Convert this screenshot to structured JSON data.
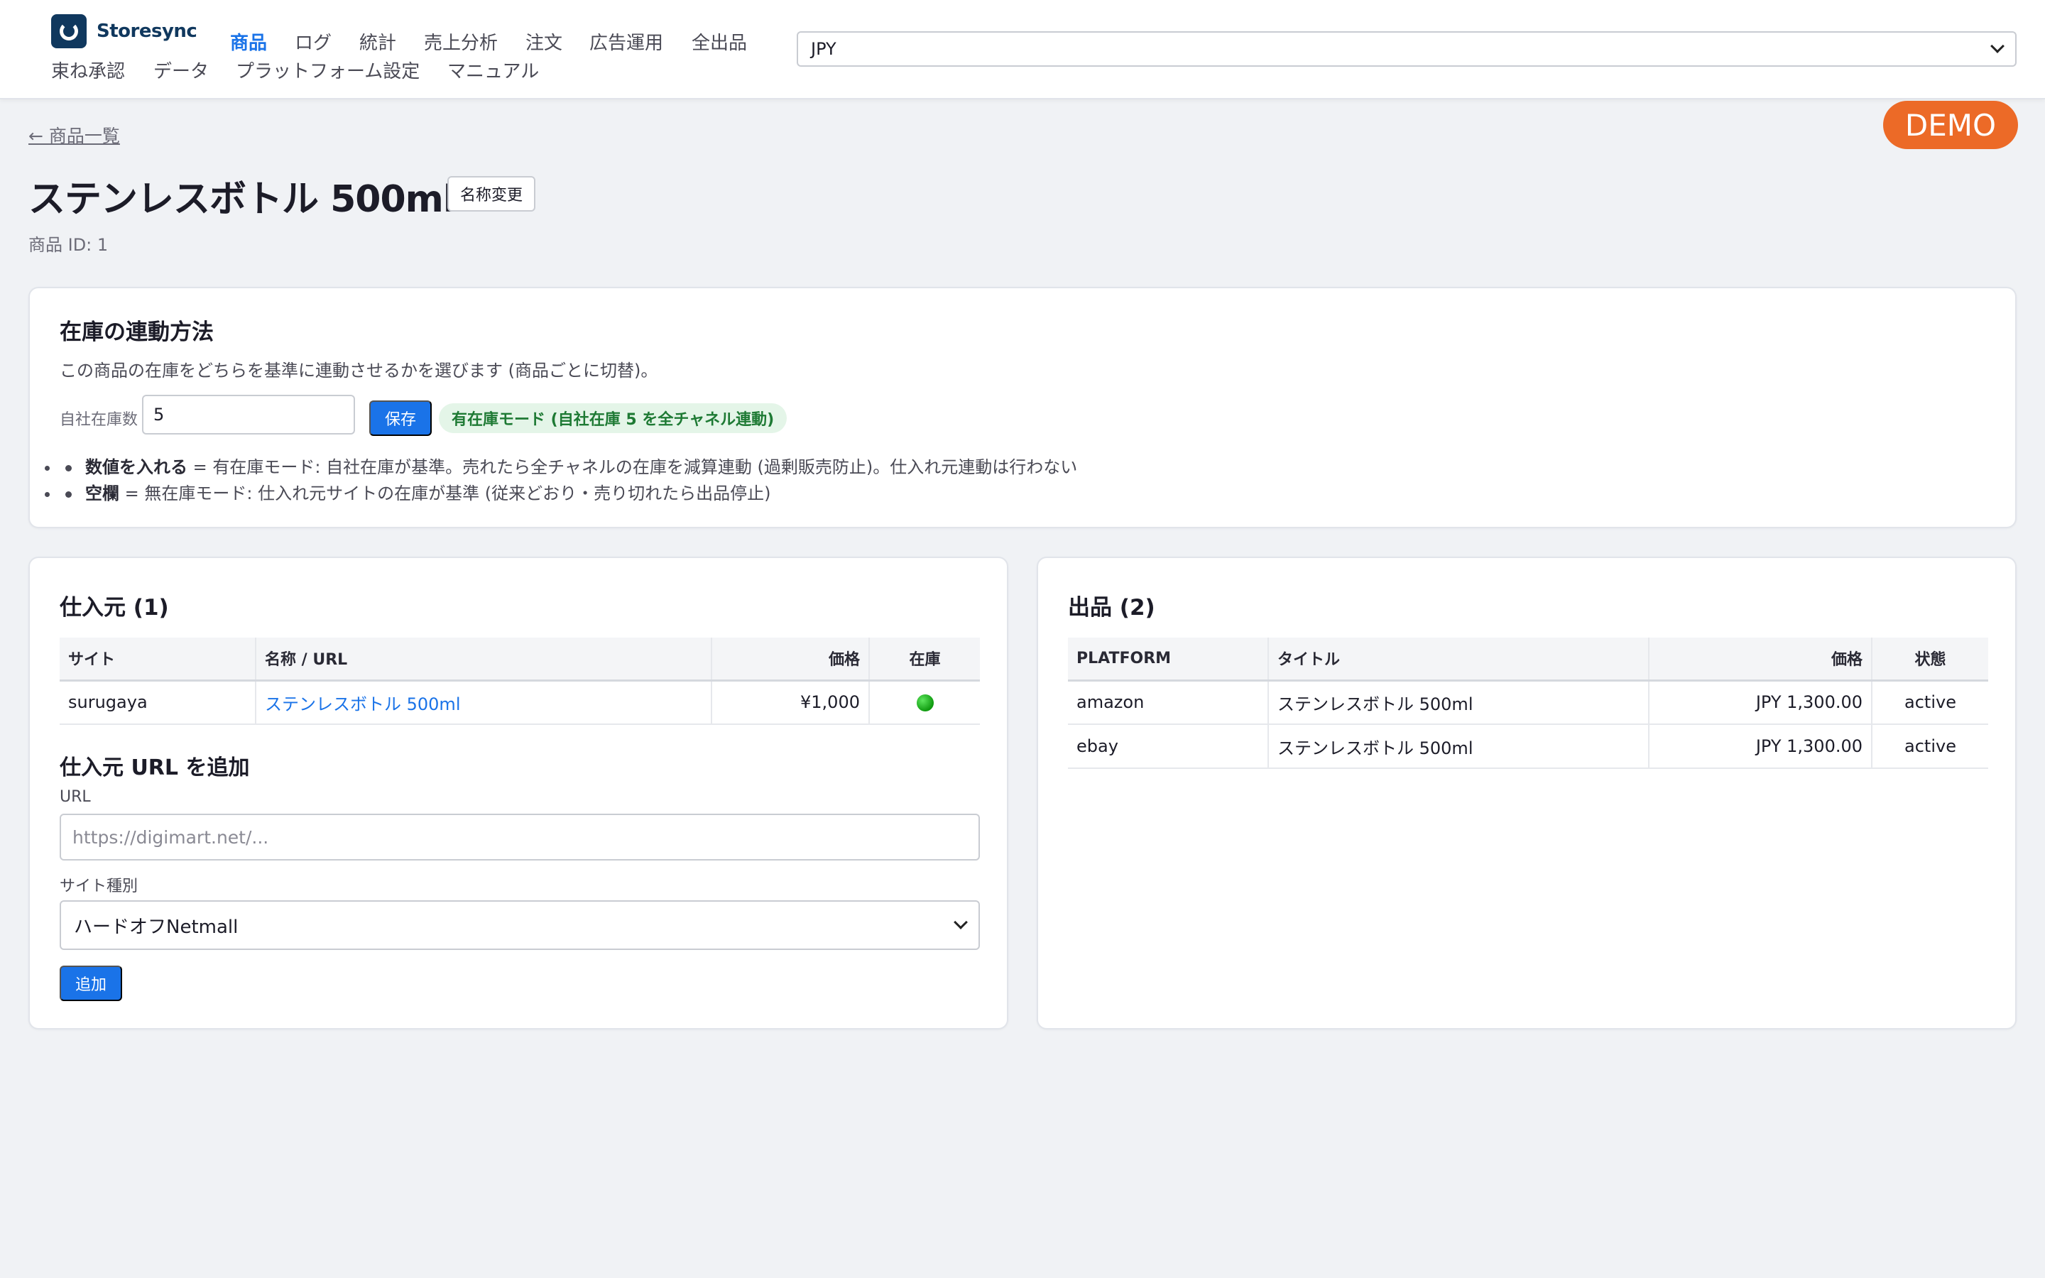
{
  "app": {
    "name": "Storesync"
  },
  "nav": {
    "items": [
      {
        "label": "商品",
        "active": true
      },
      {
        "label": "ログ"
      },
      {
        "label": "統計"
      },
      {
        "label": "売上分析"
      },
      {
        "label": "注文"
      },
      {
        "label": "広告運用"
      },
      {
        "label": "全出品"
      },
      {
        "label": "束ね承認"
      },
      {
        "label": "データ"
      },
      {
        "label": "プラットフォーム設定"
      },
      {
        "label": "マニュアル"
      }
    ]
  },
  "currency": {
    "selected": "JPY"
  },
  "demo_badge": "DEMO",
  "back_link": "← 商品一覧",
  "product": {
    "title": "ステンレスボトル 500ml",
    "rename_label": "名称変更",
    "id_text": "商品 ID: 1"
  },
  "stock_sync": {
    "title": "在庫の連動方法",
    "description": "この商品の在庫をどちらを基準に連動させるかを選びます (商品ごとに切替)。",
    "input_label": "自社在庫数",
    "input_value": "5",
    "save_label": "保存",
    "mode_badge": "有在庫モード (自社在庫 5 を全チャネル連動)",
    "bullets": [
      {
        "term": "数値を入れる",
        "text": " = 有在庫モード: 自社在庫が基準。売れたら全チャネルの在庫を減算連動 (過剰販売防止)。仕入れ元連動は行わない"
      },
      {
        "term": "空欄",
        "text": " = 無在庫モード: 仕入れ元サイトの在庫が基準 (従来どおり・売り切れたら出品停止)"
      }
    ]
  },
  "sources": {
    "title": "仕入元 (1)",
    "headers": {
      "site": "サイト",
      "name": "名称 / URL",
      "price": "価格",
      "stock": "在庫"
    },
    "rows": [
      {
        "site": "surugaya",
        "name": "ステンレスボトル 500ml",
        "price": "¥1,000",
        "in_stock": true
      }
    ],
    "add": {
      "title": "仕入元 URL を追加",
      "url_label": "URL",
      "url_placeholder": "https://digimart.net/...",
      "site_label": "サイト種別",
      "site_selected": "ハードオフNetmall",
      "add_label": "追加"
    }
  },
  "listings": {
    "title": "出品 (2)",
    "headers": {
      "platform": "PLATFORM",
      "title": "タイトル",
      "price": "価格",
      "status": "状態"
    },
    "rows": [
      {
        "platform": "amazon",
        "title": "ステンレスボトル 500ml",
        "price": "JPY 1,300.00",
        "status": "active"
      },
      {
        "platform": "ebay",
        "title": "ステンレスボトル 500ml",
        "price": "JPY 1,300.00",
        "status": "active"
      }
    ]
  }
}
